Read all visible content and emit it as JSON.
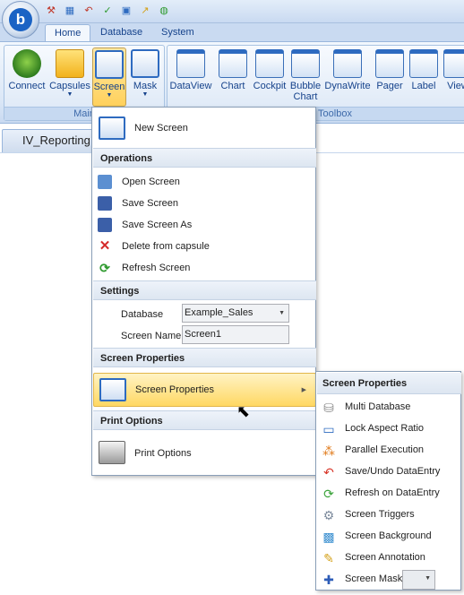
{
  "app": {
    "orb_letter": "b"
  },
  "quick_access": [
    {
      "icon": "tools-icon",
      "color": "#c0392b"
    },
    {
      "icon": "save-grid-icon",
      "color": "#2e6bc0"
    },
    {
      "icon": "undo-icon",
      "color": "#c0392b"
    },
    {
      "icon": "check-icon",
      "color": "#2e9a2e"
    },
    {
      "icon": "window-icon",
      "color": "#2e6bc0"
    },
    {
      "icon": "chart-icon",
      "color": "#d4a017"
    },
    {
      "icon": "globe-icon",
      "color": "#2e9a2e"
    }
  ],
  "tabs": [
    {
      "label": "Home",
      "active": true
    },
    {
      "label": "Database",
      "active": false
    },
    {
      "label": "System",
      "active": false
    }
  ],
  "ribbon": {
    "main_group": {
      "label": "Main",
      "buttons": [
        {
          "label": "Connect"
        },
        {
          "label": "Capsules"
        },
        {
          "label": "Screen"
        },
        {
          "label": "Mask"
        }
      ]
    },
    "toolbox_group": {
      "label": "Toolbox",
      "buttons": [
        {
          "label": "DataView",
          "accent": "#2e6bc0"
        },
        {
          "label": "Chart",
          "accent": "#e04a2a"
        },
        {
          "label": "Cockpit",
          "accent": "#7fb83a"
        },
        {
          "label": "Bubble",
          "label2": "Chart",
          "accent": "#d93b73"
        },
        {
          "label": "DynaWrite",
          "accent": "#d4a017"
        },
        {
          "label": "Pager",
          "accent": "#6b5fb5"
        },
        {
          "label": "Label",
          "accent": "#2e6bc0"
        },
        {
          "label": "View",
          "accent": "#2e6bc0"
        }
      ]
    }
  },
  "document_tab": {
    "label": "IV_Reporting"
  },
  "screen_menu": {
    "new_screen": "New Screen",
    "operations_header": "Operations",
    "operations": [
      {
        "label": "Open Screen",
        "icon": "open-screen-icon"
      },
      {
        "label": "Save Screen",
        "icon": "save-icon"
      },
      {
        "label": "Save Screen As",
        "icon": "save-as-icon"
      },
      {
        "label": "Delete from capsule",
        "icon": "delete-x-icon"
      },
      {
        "label": "Refresh Screen",
        "icon": "refresh-icon"
      }
    ],
    "settings_header": "Settings",
    "database_label": "Database",
    "database_value": "Example_Sales",
    "screen_name_label": "Screen Name",
    "screen_name_value": "Screen1",
    "screen_properties_header": "Screen Properties",
    "screen_properties_item": "Screen Properties",
    "print_options_header": "Print Options",
    "print_options_item": "Print Options"
  },
  "properties_submenu": {
    "header": "Screen Properties",
    "items": [
      {
        "label": "Multi Database",
        "icon": "multi-database-icon",
        "color": "#8a8a8a"
      },
      {
        "label": "Lock Aspect Ratio",
        "icon": "lock-aspect-icon",
        "color": "#2e6bc0"
      },
      {
        "label": "Parallel Execution",
        "icon": "parallel-icon",
        "color": "#e07a1a"
      },
      {
        "label": "Save/Undo DataEntry",
        "icon": "undo-icon",
        "color": "#d8372a"
      },
      {
        "label": "Refresh on DataEntry",
        "icon": "refresh-icon",
        "color": "#3aa33a"
      },
      {
        "label": "Screen Triggers",
        "icon": "gear-icon",
        "color": "#7c8a9c"
      },
      {
        "label": "Screen Background",
        "icon": "image-icon",
        "color": "#3a8fd0"
      },
      {
        "label": "Screen Annotation",
        "icon": "pencil-icon",
        "color": "#d4a017"
      },
      {
        "label": "Screen Mask",
        "icon": "puzzle-icon",
        "color": "#2e5db8"
      }
    ]
  }
}
